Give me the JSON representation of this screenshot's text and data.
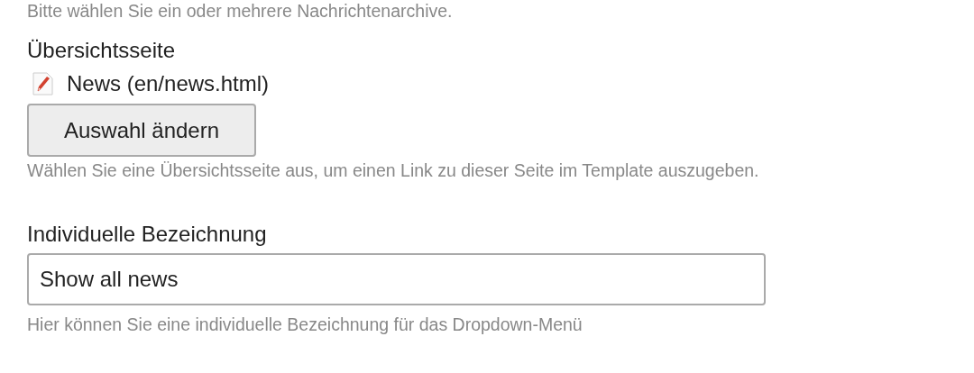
{
  "intro_hint": "Bitte wählen Sie ein oder mehrere Nachrichtenarchive.",
  "overview_page": {
    "label": "Übersichtsseite",
    "selected_page": "News (en/news.html)",
    "button": "Auswahl ändern",
    "hint": "Wählen Sie eine Übersichtsseite aus, um einen Link zu dieser Seite im Template auszugeben."
  },
  "custom_label": {
    "label": "Individuelle Bezeichnung",
    "value": "Show all news",
    "hint": "Hier können Sie eine individuelle Bezeichnung für das Dropdown-Menü"
  }
}
